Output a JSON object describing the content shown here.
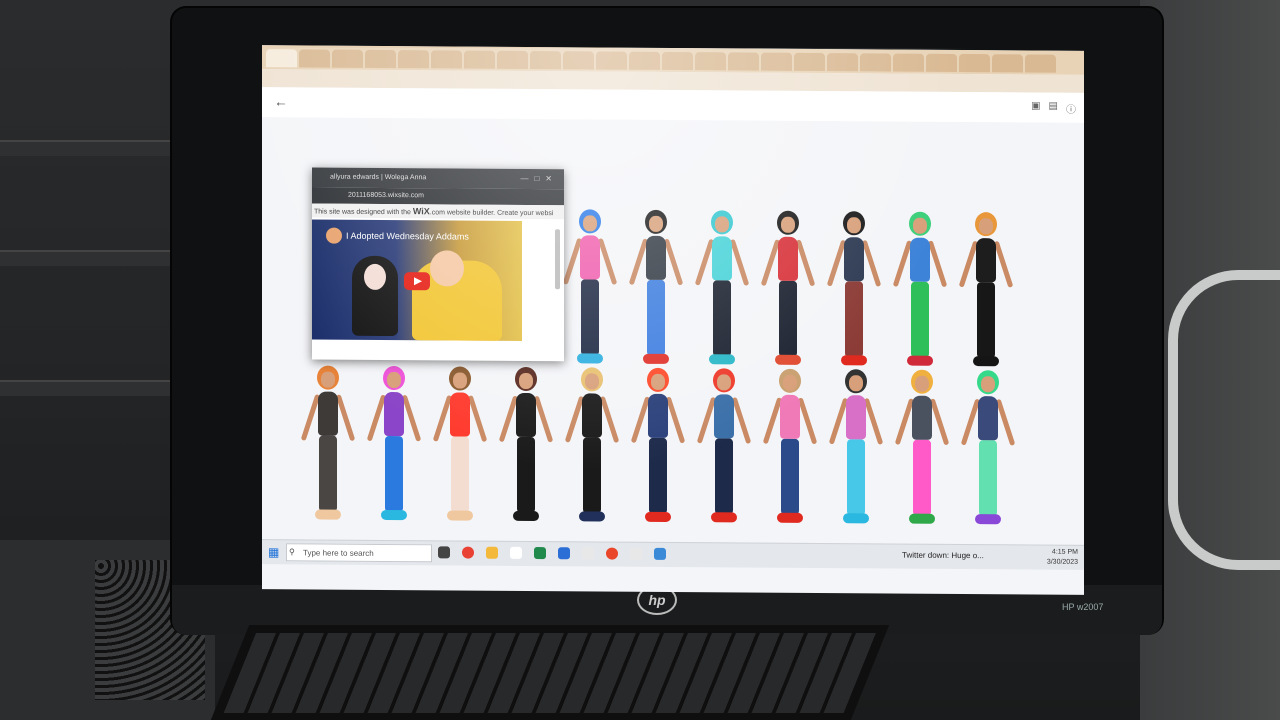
{
  "browser": {
    "tabs": [
      "",
      "",
      "",
      "",
      "",
      "",
      "",
      "",
      "",
      "",
      "",
      "",
      "",
      "",
      "",
      "",
      "",
      "",
      "",
      "",
      "",
      "",
      "",
      ""
    ]
  },
  "popup": {
    "tab_title": "allyura edwards | Wolega Anna",
    "address": "2011168053.wixsite.com",
    "banner_text": "This site was designed with the",
    "banner_brand": "WiX",
    "banner_text2": ".com website builder. Create your websi",
    "video_title": "I Adopted Wednesday Addams"
  },
  "taskbar": {
    "search_placeholder": "Type here to search",
    "running_item": "Twitter down: Huge o...",
    "time": "4:15 PM",
    "date": "3/30/2023"
  },
  "monitor": {
    "brand": "hp",
    "model": "HP w2007"
  },
  "colors": {
    "taskbar_bg": "#e4e7ec",
    "tabbar_bg": "#e8d3b6",
    "youtube_red": "#e62117"
  },
  "figures": [
    {
      "hair": "#2b7be8",
      "top": "#f05fae",
      "legs": "#1f2a44",
      "feet": "#2fb0e0",
      "row": 0
    },
    {
      "hair": "#1a1a1a",
      "top": "#333a44",
      "legs": "#3f7fe0",
      "feet": "#e0322a",
      "row": 0
    },
    {
      "hair": "#35c8d0",
      "top": "#48d3d8",
      "legs": "#1c2230",
      "feet": "#2ab8c8",
      "row": 0
    },
    {
      "hair": "#1a1a1a",
      "top": "#d8323a",
      "legs": "#1c2230",
      "feet": "#e04a30",
      "row": 0
    },
    {
      "hair": "#1a1a1a",
      "top": "#2d3a52",
      "legs": "#8c3b36",
      "feet": "#e02a20",
      "row": 0
    },
    {
      "hair": "#3ccf7a",
      "top": "#3d83d8",
      "legs": "#2fbf5a",
      "feet": "#d02a3a",
      "row": 0
    },
    {
      "hair": "#e8983a",
      "top": "#1d1d1d",
      "legs": "#171717",
      "feet": "#151515",
      "row": 0
    },
    {
      "hair": "#e8843a",
      "top": "#3d3a38",
      "legs": "#4a4644",
      "feet": "#f0c8a0",
      "row": 1
    },
    {
      "hair": "#ee55d8",
      "top": "#8b45c8",
      "legs": "#2a7ae0",
      "feet": "#2ab8e0",
      "row": 1
    },
    {
      "hair": "#8a5a2e",
      "top": "#ff3a2e",
      "legs": "#f3ddd0",
      "feet": "#f0c8a0",
      "row": 1
    },
    {
      "hair": "#5a2a20",
      "top": "#1a1a1a",
      "legs": "#1a1a1a",
      "feet": "#1a1a1a",
      "row": 1
    },
    {
      "hair": "#e8c070",
      "top": "#1a1a1a",
      "legs": "#1a1a1a",
      "feet": "#20305a",
      "row": 1
    },
    {
      "hair": "#ff4a2a",
      "top": "#2a3f7a",
      "legs": "#1e2a4a",
      "feet": "#e02a20",
      "row": 1
    },
    {
      "hair": "#ee3a2a",
      "top": "#3a6fa8",
      "legs": "#1e2a4a",
      "feet": "#e02a20",
      "row": 1
    },
    {
      "hair": "#c9a070",
      "top": "#f07ab8",
      "legs": "#2a4a8a",
      "feet": "#e02a20",
      "row": 1
    },
    {
      "hair": "#333333",
      "top": "#d870c8",
      "legs": "#48c8e8",
      "feet": "#2ab8e0",
      "row": 1
    },
    {
      "hair": "#f0b040",
      "top": "#4a5260",
      "legs": "#ff5ac8",
      "feet": "#2fa84a",
      "row": 1
    },
    {
      "hair": "#36d88a",
      "top": "#3a4a7a",
      "legs": "#62e0b0",
      "feet": "#8a48d8",
      "row": 1
    }
  ]
}
